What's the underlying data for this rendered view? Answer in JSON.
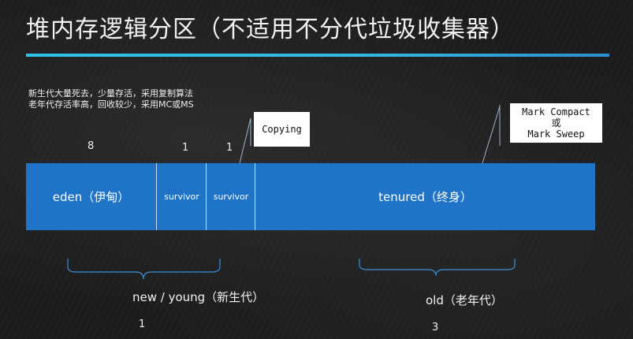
{
  "slide": {
    "title": "堆内存逻辑分区（不适用不分代垃圾收集器）",
    "notes": [
      "新生代大量死去，少量存活，采用复制算法",
      "老年代存活率高，回收较少，采用MC或MS"
    ]
  },
  "ratios": {
    "eden": "8",
    "survivor1": "1",
    "survivor2": "1"
  },
  "segments": {
    "eden": "eden（伊甸）",
    "survivor1": "survivor",
    "survivor2": "survivor",
    "tenured": "tenured（终身）"
  },
  "callouts": {
    "copying": "Copying",
    "mark_compact_line1": "Mark Compact",
    "mark_compact_line2": "或",
    "mark_compact_line3": "Mark Sweep"
  },
  "groups": {
    "young_label": "new / young（新生代）",
    "young_ratio": "1",
    "old_label": "old（老年代）",
    "old_ratio": "3"
  },
  "colors": {
    "segment_fill": "#1f74c8",
    "title_rule": "#2ec4ea",
    "brace": "#3c8fd6"
  }
}
